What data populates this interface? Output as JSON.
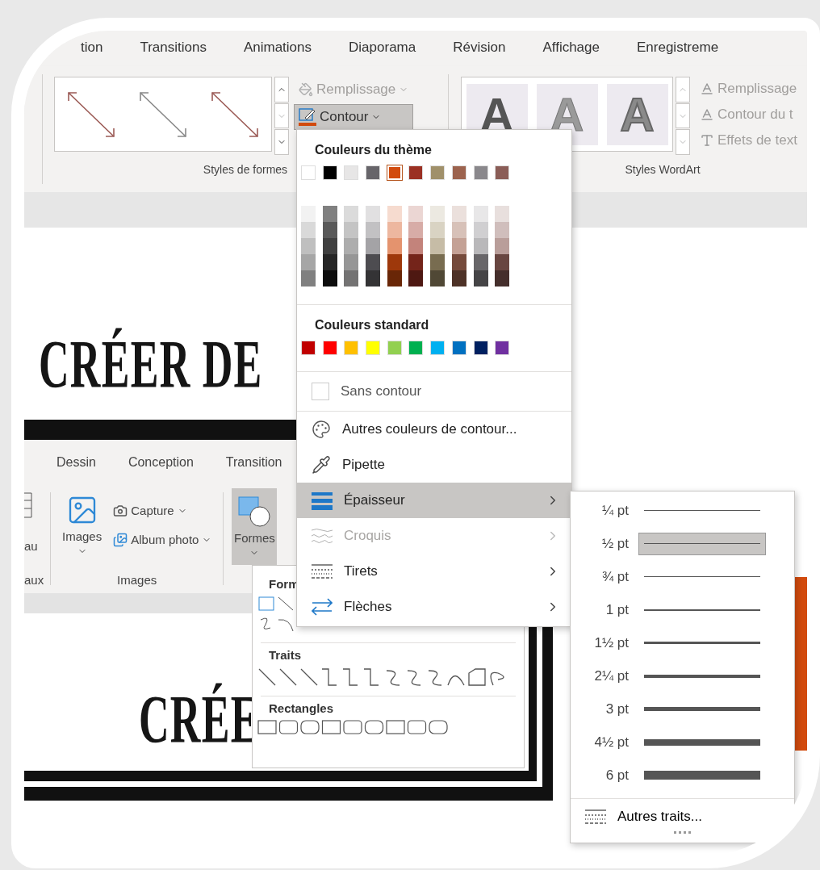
{
  "ribbon": {
    "tabs": [
      {
        "label": "tion",
        "selected": false
      },
      {
        "label": "Transitions",
        "selected": false
      },
      {
        "label": "Animations",
        "selected": false
      },
      {
        "label": "Diaporama",
        "selected": false
      },
      {
        "label": "Révision",
        "selected": false
      },
      {
        "label": "Affichage",
        "selected": false
      },
      {
        "label": "Enregistreme",
        "selected": false
      }
    ],
    "shape_styles": {
      "group_label": "Styles de formes",
      "fill_button": {
        "label": "Remplissage",
        "disabled": true
      },
      "outline_button": {
        "label": "Contour",
        "pressed": true
      }
    },
    "wordart_styles": {
      "group_label": "Styles WordArt",
      "samples": [
        "A",
        "A",
        "A"
      ],
      "buttons": [
        {
          "label": "Remplissage",
          "disabled": true
        },
        {
          "label": "Contour du t",
          "disabled": true
        },
        {
          "label": "Effets de text",
          "disabled": true
        }
      ]
    }
  },
  "slide": {
    "title": "CRÉER DE",
    "inner_screenshot": {
      "tabs": [
        "Dessin",
        "Conception",
        "Transition"
      ],
      "partial_button": "au",
      "partial_group_label": "aux",
      "images_button": "Images",
      "capture_button": "Capture",
      "album_button": "Album photo",
      "images_group_label": "Images",
      "shapes_button": {
        "label": "Formes",
        "pressed": true
      },
      "shapes_panel": {
        "sections": [
          "Form",
          "Traits",
          "Rectangles"
        ]
      },
      "title": "CRÉE"
    }
  },
  "outline_menu": {
    "theme_heading": "Couleurs du thème",
    "theme_colors": [
      {
        "color": "#ffffff",
        "selected": false
      },
      {
        "color": "#000000",
        "selected": false
      },
      {
        "color": "#e7e6e6",
        "selected": false
      },
      {
        "color": "#67656a",
        "selected": false
      },
      {
        "color": "#d24b0e",
        "selected": true
      },
      {
        "color": "#9b3023",
        "selected": false
      },
      {
        "color": "#a0906a",
        "selected": false
      },
      {
        "color": "#9c634e",
        "selected": false
      },
      {
        "color": "#8a888c",
        "selected": false
      },
      {
        "color": "#8a5d57",
        "selected": false
      }
    ],
    "standard_heading": "Couleurs standard",
    "standard_colors": [
      {
        "color": "#c00000"
      },
      {
        "color": "#ff0000"
      },
      {
        "color": "#ffc000"
      },
      {
        "color": "#ffff00"
      },
      {
        "color": "#92d050"
      },
      {
        "color": "#00b050"
      },
      {
        "color": "#00b0f0"
      },
      {
        "color": "#0070c0"
      },
      {
        "color": "#002060"
      },
      {
        "color": "#7030a0"
      }
    ],
    "no_outline": {
      "label": "Sans contour",
      "checked": false
    },
    "items": [
      {
        "label": "Autres couleurs de contour...",
        "selected": false,
        "disabled": false,
        "submenu": false
      },
      {
        "label": "Pipette",
        "selected": false,
        "disabled": false,
        "submenu": false
      },
      {
        "label": "Épaisseur",
        "selected": true,
        "disabled": false,
        "submenu": true
      },
      {
        "label": "Croquis",
        "selected": false,
        "disabled": true,
        "submenu": true
      },
      {
        "label": "Tirets",
        "selected": false,
        "disabled": false,
        "submenu": true
      },
      {
        "label": "Flèches",
        "selected": false,
        "disabled": false,
        "submenu": true
      }
    ]
  },
  "weight_menu": {
    "items": [
      {
        "label": "¼ pt",
        "selected": false
      },
      {
        "label": "½ pt",
        "selected": true
      },
      {
        "label": "¾ pt",
        "selected": false
      },
      {
        "label": "1 pt",
        "selected": false
      },
      {
        "label": "1½ pt",
        "selected": false
      },
      {
        "label": "2¼ pt",
        "selected": false
      },
      {
        "label": "3 pt",
        "selected": false
      },
      {
        "label": "4½ pt",
        "selected": false
      },
      {
        "label": "6 pt",
        "selected": false
      }
    ],
    "more": "Autres traits..."
  }
}
